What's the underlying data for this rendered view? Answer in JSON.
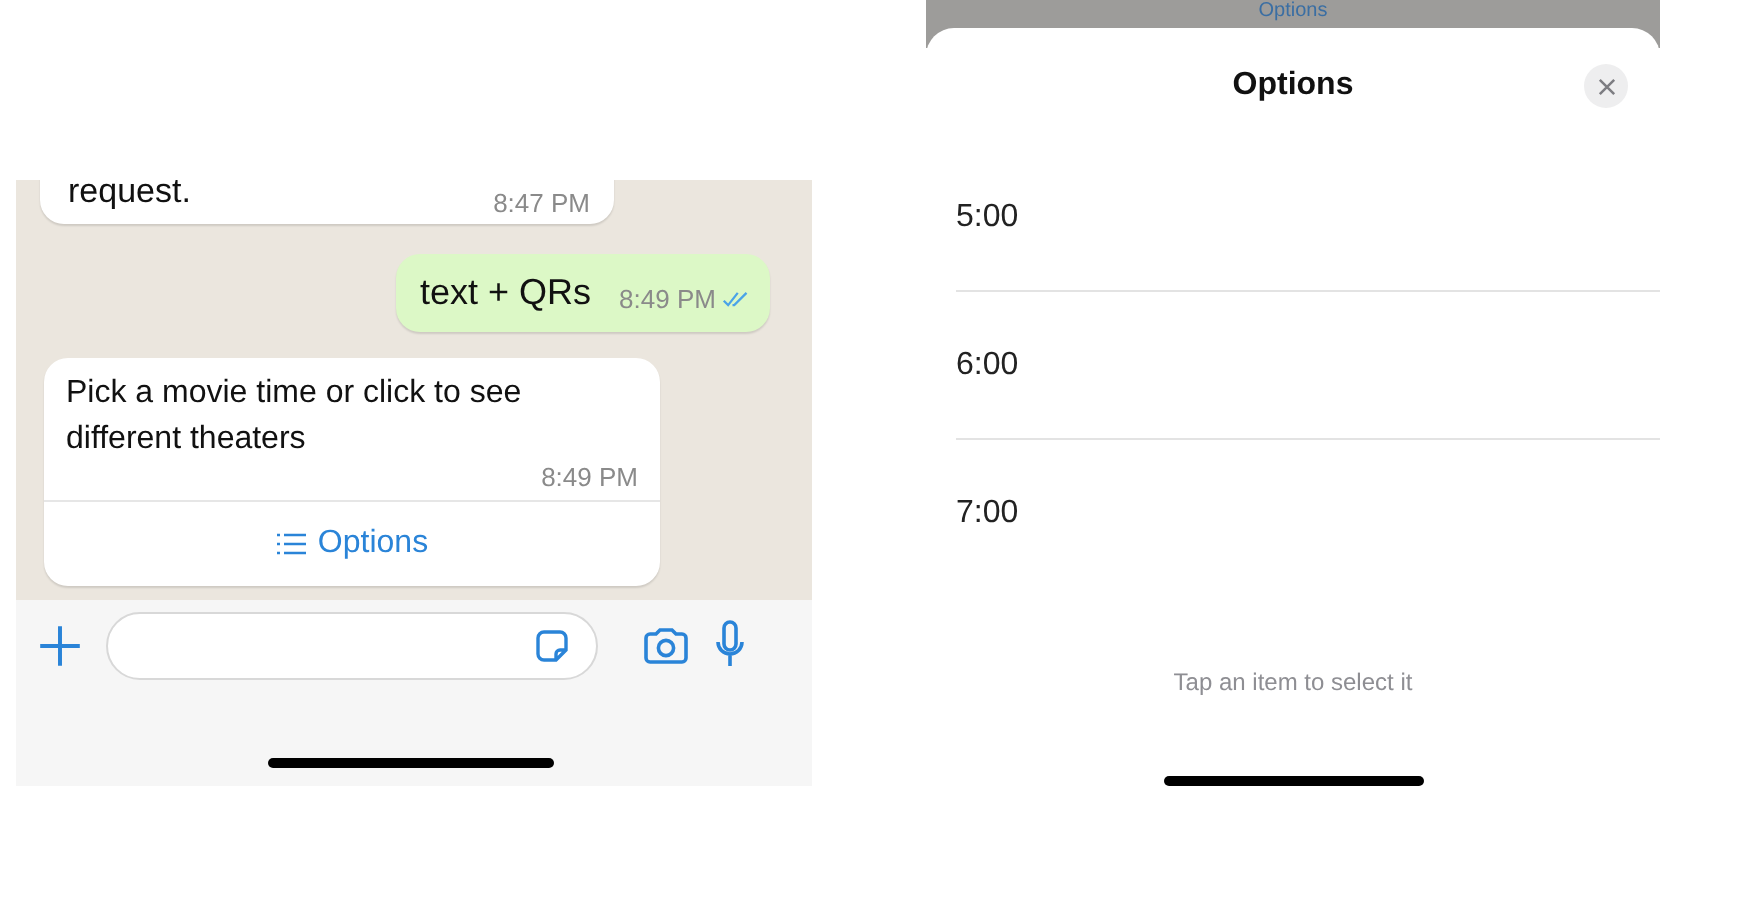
{
  "chat": {
    "messages": [
      {
        "kind": "incoming",
        "text": "request.",
        "time": "8:47 PM"
      },
      {
        "kind": "outgoing",
        "text": "text + QRs",
        "time": "8:49 PM",
        "read": true
      },
      {
        "kind": "list",
        "text": "Pick a movie time or click to see different theaters",
        "time": "8:49 PM",
        "button": "Options"
      }
    ]
  },
  "sheet": {
    "behind_label": "Options",
    "title": "Options",
    "items": [
      {
        "label": "5:00"
      },
      {
        "label": "6:00"
      },
      {
        "label": "7:00"
      }
    ],
    "hint": "Tap an item to select it"
  }
}
